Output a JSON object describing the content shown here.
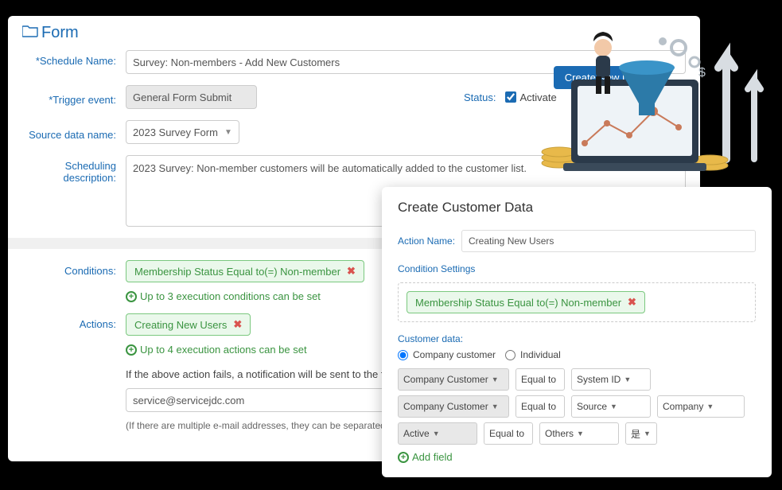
{
  "form": {
    "title": "Form",
    "schedule_name_label": "*Schedule Name:",
    "schedule_name_value": "Survey: Non-members - Add New Customers",
    "trigger_label": "*Trigger event:",
    "trigger_value": "General Form Submit",
    "status_label": "Status:",
    "activate_label": "Activate",
    "source_label": "Source data name:",
    "source_value": "2023 Survey Form",
    "desc_label": "Scheduling description:",
    "desc_value": "2023 Survey: Non-member customers will be automatically added to the customer list.",
    "conditions_label": "Conditions:",
    "condition_tag": "Membership Status Equal to(=) Non-member",
    "condition_hint": "Up to 3 execution conditions can be set",
    "actions_label": "Actions:",
    "action_tag": "Creating New Users",
    "action_hint": "Up to 4 execution actions can be set",
    "fail_text": "If the above action fails, a notification will be sent to the following email address.",
    "email_value": "service@servicejdc.com",
    "email_note": "(If there are multiple e-mail addresses, they can be separated by commas.)",
    "btn_create": "Create New Users"
  },
  "modal": {
    "title": "Create Customer Data",
    "action_name_label": "Action Name:",
    "action_name_value": "Creating New Users",
    "cond_settings": "Condition Settings",
    "cond_tag": "Membership Status Equal to(=) Non-member",
    "cust_data_label": "Customer data:",
    "radio_company": "Company customer",
    "radio_individual": "Individual",
    "rows": [
      {
        "a": "Company Customer",
        "b": "Equal to",
        "c": "System ID",
        "d": ""
      },
      {
        "a": "Company Customer",
        "b": "Equal to",
        "c": "Source",
        "d": "Company"
      },
      {
        "a": "Active",
        "b": "Equal to",
        "c": "Others",
        "d": "是"
      }
    ],
    "add_field": "Add field"
  }
}
